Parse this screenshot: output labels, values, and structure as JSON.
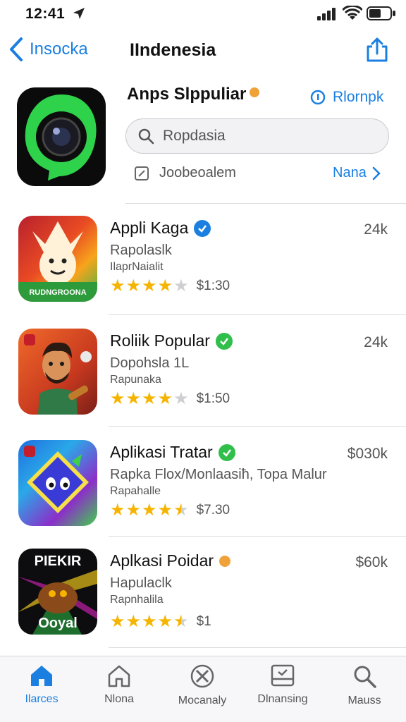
{
  "status_bar": {
    "time": "12:41"
  },
  "nav": {
    "back_label": "Insocka",
    "title": "IIndenesia"
  },
  "featured": {
    "title": "Anps Slppuliar",
    "action_label": "Rlornpk",
    "search_text": "Ropdasia",
    "row_label": "Joobeoalem",
    "row_link": "Nana",
    "colors": {
      "accent": "#1a7fe0",
      "icon_green": "#2fd24b"
    }
  },
  "apps": [
    {
      "name": "Appli Kaga",
      "sub1": "Rapolaslk",
      "sub2": "IlaprNaialit",
      "rating": 4,
      "price": "$1:30",
      "count": "24k",
      "badge_color": "#1a7fe0",
      "icon_caption": "RUDNGROONA"
    },
    {
      "name": "Roliik Popular",
      "sub1": "Dopohsla 1L",
      "sub2": "Rapunaka",
      "rating": 4,
      "price": "$1:50",
      "count": "24k",
      "badge_color": "#2fbf4a",
      "icon_caption": ""
    },
    {
      "name": "Aplikasi Tratar",
      "sub1": "Rapka Flox/Monlaasiħ, Topa Malur",
      "sub2": "Rapahalle",
      "rating": 4.5,
      "price": "$7.30",
      "count": "$030k",
      "badge_color": "#2fbf4a",
      "icon_caption": ""
    },
    {
      "name": "Aplkasi Poidar",
      "sub1": "Hapulaclk",
      "sub2": "Rapnhalila",
      "rating": 4.5,
      "price": "$1",
      "count": "$60k",
      "badge_color": "#f0a23a",
      "icon_caption": "PIEKIR",
      "icon_caption2": "Ooyal"
    }
  ],
  "tabs": [
    {
      "label": "Ilarces",
      "icon": "home-icon",
      "active": true
    },
    {
      "label": "Nlona",
      "icon": "house-outline-icon",
      "active": false
    },
    {
      "label": "Mocanaly",
      "icon": "compass-icon",
      "active": false
    },
    {
      "label": "Dlnansing",
      "icon": "inbox-check-icon",
      "active": false
    },
    {
      "label": "Mauss",
      "icon": "search-icon",
      "active": false
    }
  ]
}
